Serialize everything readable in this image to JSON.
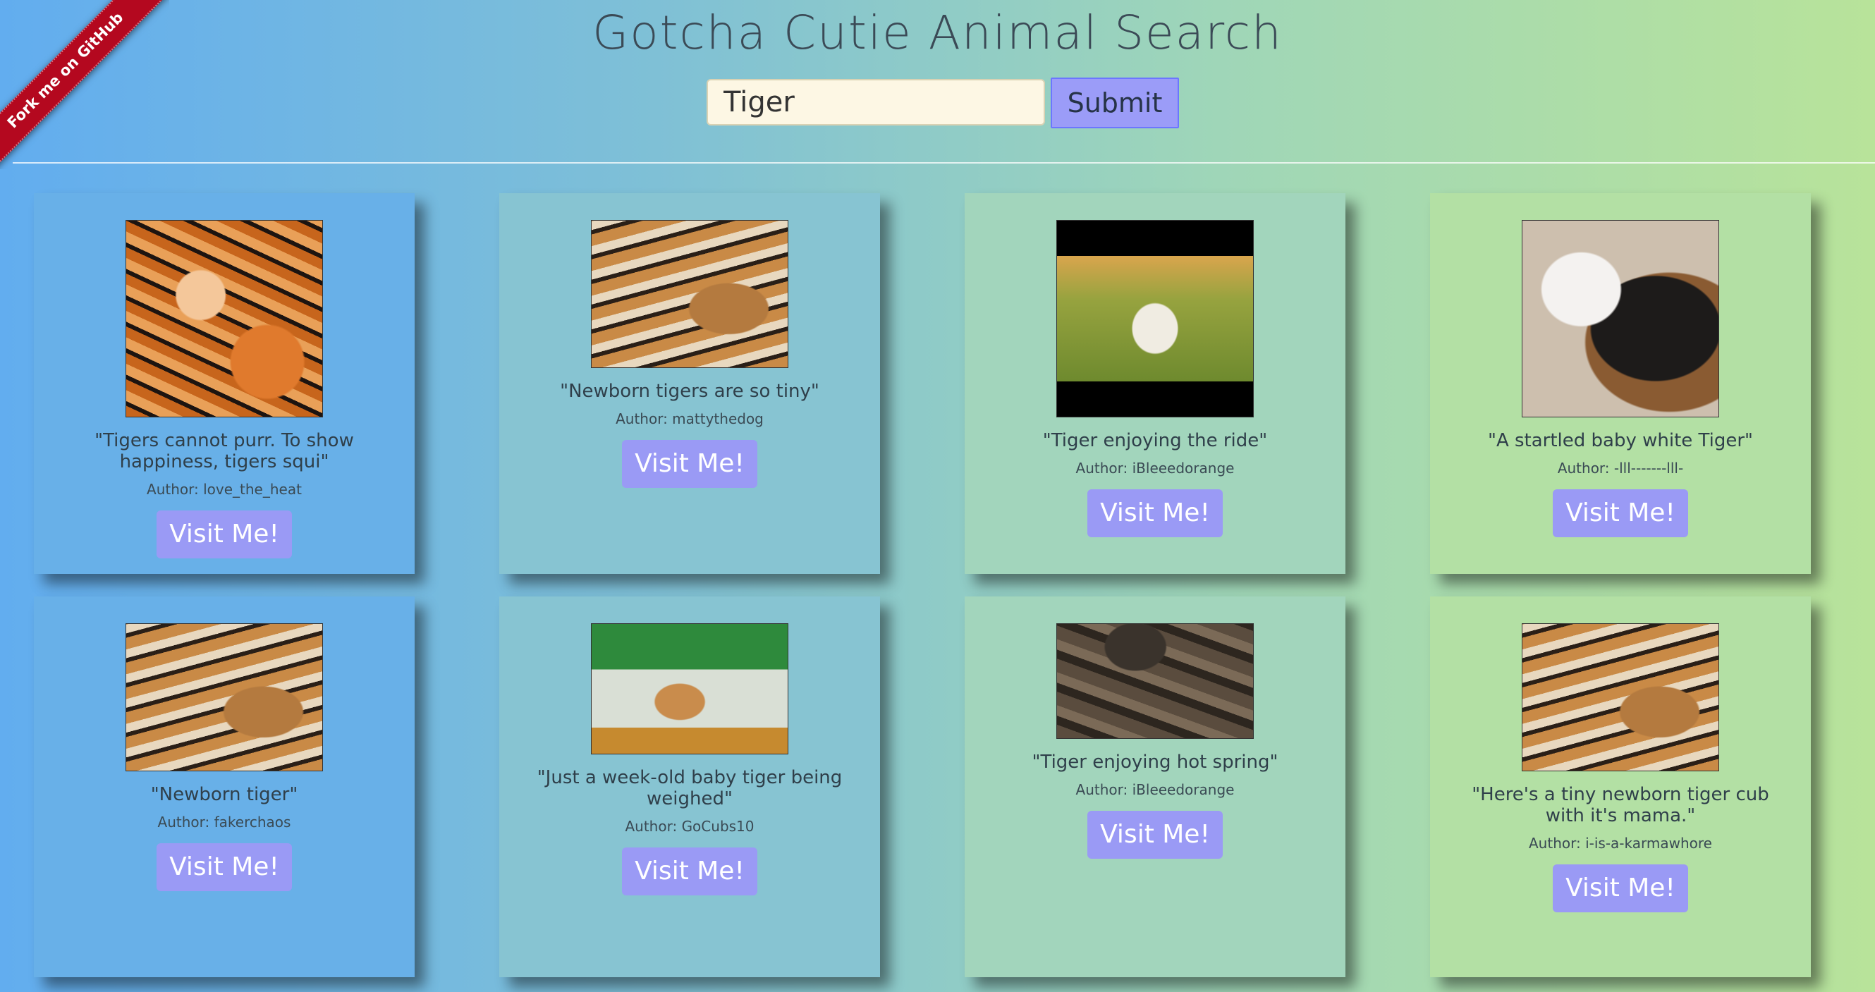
{
  "ribbon": {
    "label": "Fork me on GitHub",
    "color": "#b4081f"
  },
  "header": {
    "title": "Gotcha Cutie Animal Search",
    "search": {
      "value": "Tiger",
      "placeholder": ""
    },
    "submit_label": "Submit"
  },
  "colors": {
    "accent_button": "#9a9af5",
    "input_bg": "#fdf7e4"
  },
  "cards": [
    {
      "image": "tiger-mother-and-cub",
      "quote": "\"Tigers cannot purr. To show happiness, tigers squi\"",
      "author": "Author: love_the_heat",
      "button": "Visit Me!"
    },
    {
      "image": "sleeping-tiger-with-cubs",
      "quote": "\"Newborn tigers are so tiny\"",
      "author": "Author: mattythedog",
      "button": "Visit Me!"
    },
    {
      "image": "white-tiger-on-grass",
      "quote": "\"Tiger enjoying the ride\"",
      "author": "Author: iBleeedorange",
      "button": "Visit Me!"
    },
    {
      "image": "white-tiger-cub-and-dog",
      "quote": "\"A startled baby white Tiger\"",
      "author": "Author: -lll-------lll-",
      "button": "Visit Me!"
    },
    {
      "image": "sleeping-tiger-with-cubs",
      "quote": "\"Newborn tiger\"",
      "author": "Author: fakerchaos",
      "button": "Visit Me!"
    },
    {
      "image": "tiger-cub-in-plastic-box",
      "quote": "\"Just a week-old baby tiger being weighed\"",
      "author": "Author: GoCubs10",
      "button": "Visit Me!"
    },
    {
      "image": "tiger-in-hot-spring",
      "quote": "\"Tiger enjoying hot spring\"",
      "author": "Author: iBleeedorange",
      "button": "Visit Me!"
    },
    {
      "image": "sleeping-tiger-with-cubs",
      "quote": "\"Here's a tiny newborn tiger cub with it's mama.\"",
      "author": "Author: i-is-a-karmawhore",
      "button": "Visit Me!"
    }
  ]
}
